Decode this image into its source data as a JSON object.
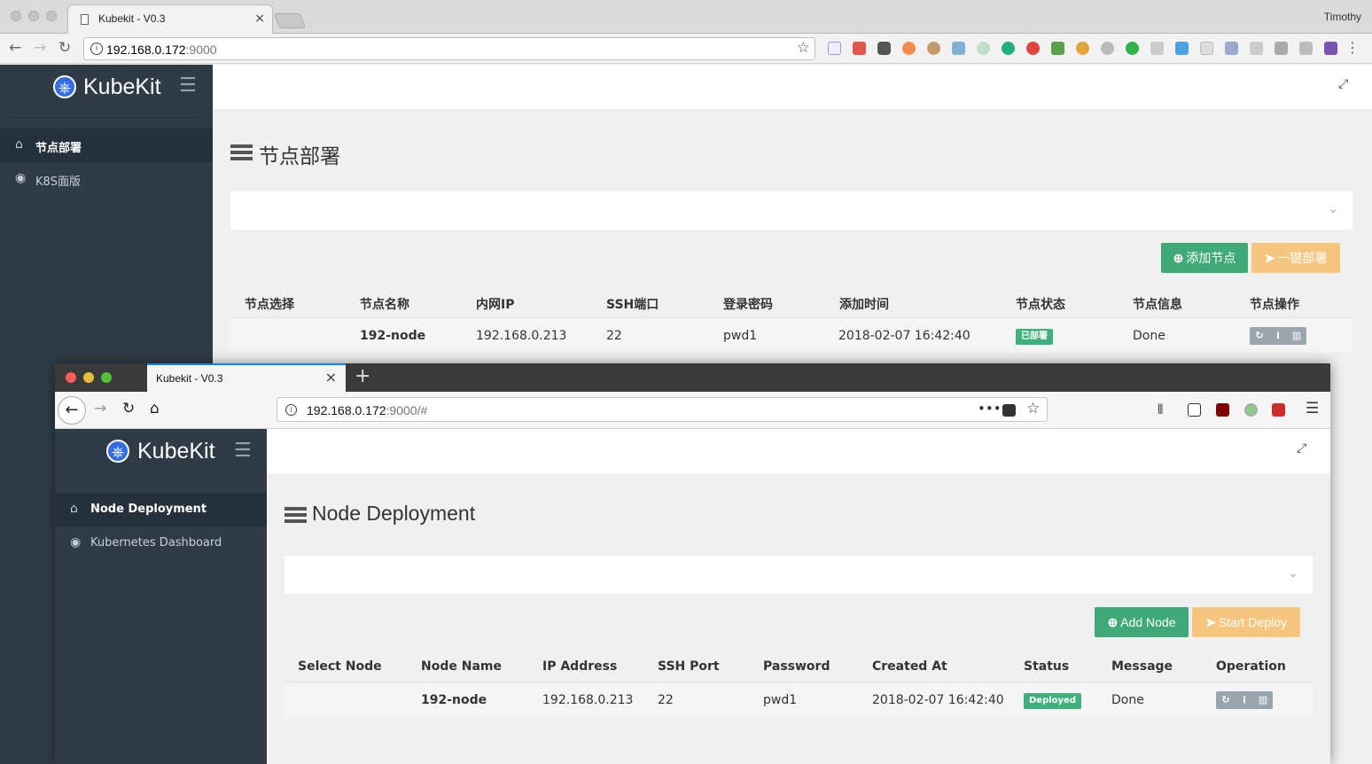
{
  "back_window": {
    "tab_title": "Kubekit - V0.3",
    "tab_close": "×",
    "profile_name": "Timothy",
    "url_host": "192.168.0.172",
    "url_port": ":9000",
    "brand": "KubeKit",
    "sidebar_items": [
      {
        "label": "节点部署",
        "icon": "home-icon",
        "active": true
      },
      {
        "label": "K8S面版",
        "icon": "dashboard-icon",
        "active": false
      }
    ],
    "page_title": "节点部署",
    "buttons": {
      "add_node": "添加节点",
      "deploy": "一键部署"
    },
    "table": {
      "headers": [
        "节点选择",
        "节点名称",
        "内网IP",
        "SSH端口",
        "登录密码",
        "添加时间",
        "节点状态",
        "节点信息",
        "节点操作"
      ],
      "rows": [
        {
          "name": "192-node",
          "ip": "192.168.0.213",
          "port": "22",
          "password": "pwd1",
          "created": "2018-02-07 16:42:40",
          "status": "已部署",
          "message": "Done"
        }
      ]
    }
  },
  "front_window": {
    "tab_title": "Kubekit - V0.3",
    "tab_close": "×",
    "url_host": "192.168.0.172",
    "url_rest": ":9000/#",
    "brand": "KubeKit",
    "sidebar_items": [
      {
        "label": "Node Deployment",
        "icon": "home-icon",
        "active": true
      },
      {
        "label": "Kubernetes Dashboard",
        "icon": "dashboard-icon",
        "active": false
      }
    ],
    "page_title": "Node Deployment",
    "buttons": {
      "add_node": "Add Node",
      "deploy": "Start Deploy"
    },
    "table": {
      "headers": [
        "Select Node",
        "Node Name",
        "IP Address",
        "SSH Port",
        "Password",
        "Created At",
        "Status",
        "Message",
        "Operation"
      ],
      "rows": [
        {
          "name": "192-node",
          "ip": "192.168.0.213",
          "port": "22",
          "password": "pwd1",
          "created": "2018-02-07 16:42:40",
          "status": "Deployed",
          "message": "Done"
        }
      ]
    }
  },
  "colors": {
    "sidebar": "#2f3b45",
    "green": "#3fa978",
    "orange": "#f6c67e",
    "status_badge": "#3fb17c",
    "ops_group": "#9aa6ad"
  }
}
